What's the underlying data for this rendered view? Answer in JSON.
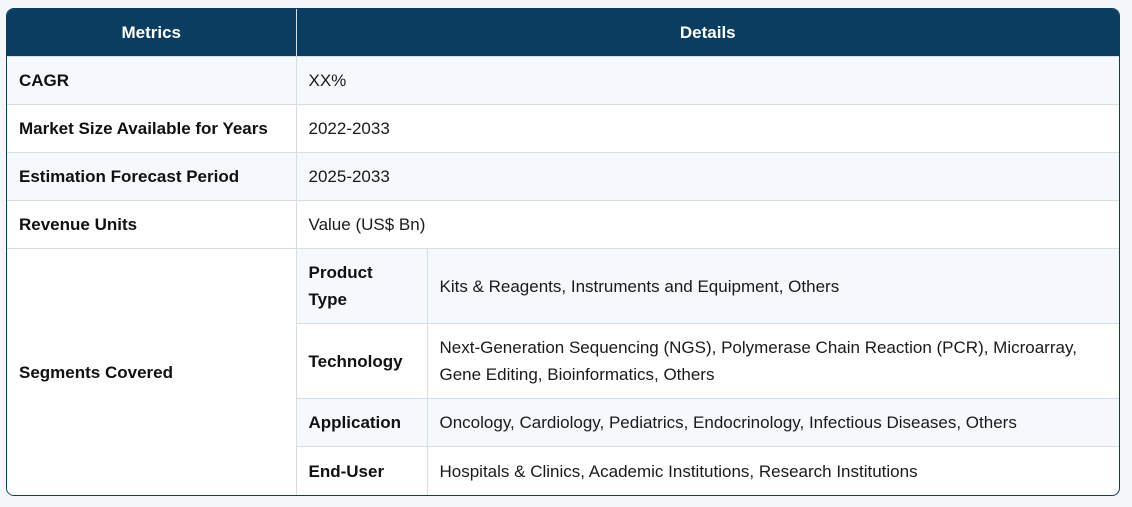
{
  "header": {
    "metrics": "Metrics",
    "details": "Details"
  },
  "rows": [
    {
      "metric": "CAGR",
      "details": "XX%"
    },
    {
      "metric": "Market Size Available for Years",
      "details": "2022-2033"
    },
    {
      "metric": "Estimation Forecast Period",
      "details": "2025-2033"
    },
    {
      "metric": "Revenue Units",
      "details": "Value (US$ Bn)"
    }
  ],
  "segments": {
    "label": "Segments Covered",
    "items": [
      {
        "name": "Product Type",
        "details": "Kits & Reagents, Instruments and Equipment, Others"
      },
      {
        "name": "Technology",
        "details": "Next-Generation Sequencing (NGS), Polymerase Chain Reaction (PCR), Microarray, Gene Editing, Bioinformatics, Others"
      },
      {
        "name": "Application",
        "details": "Oncology, Cardiology, Pediatrics, Endocrinology, Infectious Diseases, Others"
      },
      {
        "name": "End-User",
        "details": "Hospitals & Clinics, Academic Institutions, Research Institutions"
      }
    ]
  }
}
